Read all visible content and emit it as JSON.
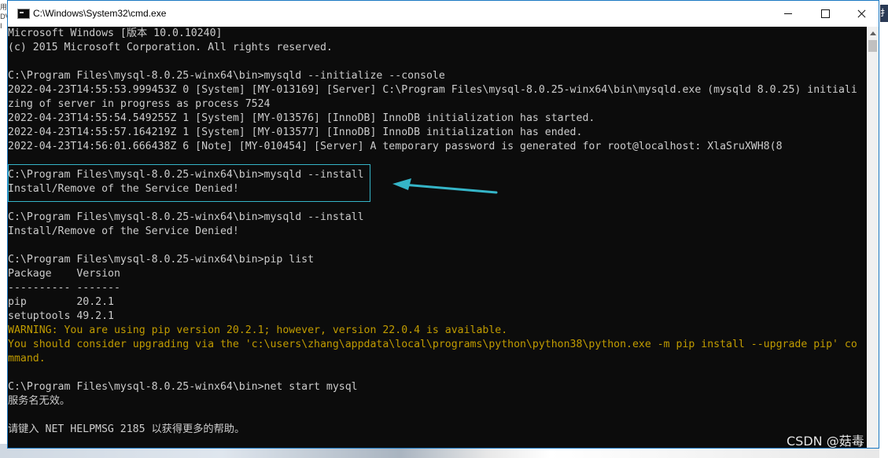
{
  "window": {
    "title": "C:\\Windows\\System32\\cmd.exe",
    "frame_color": "#1a78c2"
  },
  "console": {
    "background": "#0c0c0c",
    "text_color": "#cccccc",
    "warning_color": "#c19c00",
    "lines": [
      "Microsoft Windows [版本 10.0.10240]",
      "(c) 2015 Microsoft Corporation. All rights reserved.",
      "",
      "C:\\Program Files\\mysql-8.0.25-winx64\\bin>mysqld --initialize --console",
      "2022-04-23T14:55:53.999453Z 0 [System] [MY-013169] [Server] C:\\Program Files\\mysql-8.0.25-winx64\\bin\\mysqld.exe (mysqld 8.0.25) initiali",
      "zing of server in progress as process 7524",
      "2022-04-23T14:55:54.549255Z 1 [System] [MY-013576] [InnoDB] InnoDB initialization has started.",
      "2022-04-23T14:55:57.164219Z 1 [System] [MY-013577] [InnoDB] InnoDB initialization has ended.",
      "2022-04-23T14:56:01.666438Z 6 [Note] [MY-010454] [Server] A temporary password is generated for root@localhost: XlaSruXWH8(8",
      "",
      "C:\\Program Files\\mysql-8.0.25-winx64\\bin>mysqld --install",
      "Install/Remove of the Service Denied!",
      "",
      "C:\\Program Files\\mysql-8.0.25-winx64\\bin>mysqld --install",
      "Install/Remove of the Service Denied!",
      "",
      "C:\\Program Files\\mysql-8.0.25-winx64\\bin>pip list",
      "Package    Version",
      "---------- -------",
      "pip        20.2.1",
      "setuptools 49.2.1",
      "WARNING: You are using pip version 20.2.1; however, version 22.0.4 is available.",
      "You should consider upgrading via the 'c:\\users\\zhang\\appdata\\local\\programs\\python\\python38\\python.exe -m pip install --upgrade pip' co",
      "mmand.",
      "",
      "C:\\Program Files\\mysql-8.0.25-winx64\\bin>net start mysql",
      "服务名无效。",
      "",
      "请键入 NET HELPMSG 2185 以获得更多的帮助。"
    ]
  },
  "annotation": {
    "box_color": "#35b5c8",
    "arrow_color": "#35b5c8"
  },
  "watermark": {
    "text": "CSDN @菇毒"
  },
  "edge": {
    "left_glyph": "用\nDV\nI",
    "right_glyph": "扌"
  }
}
